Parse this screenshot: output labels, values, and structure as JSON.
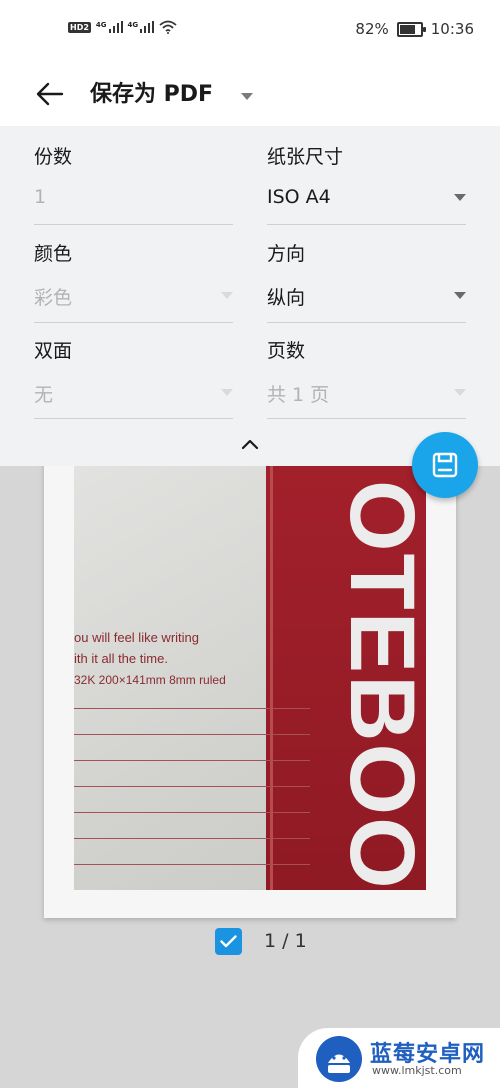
{
  "status_bar": {
    "hd_label": "HD",
    "hd_sub": "2",
    "signal1_label": "4G",
    "signal2_label": "4G",
    "battery_percent": "82%",
    "battery_level": 0.82,
    "time": "10:36"
  },
  "app_bar": {
    "back_icon": "arrow-left-icon",
    "title": "保存为 PDF",
    "title_dropdown_icon": "caret-down-icon"
  },
  "settings": {
    "copies": {
      "label": "份数",
      "value": "1",
      "enabled": false
    },
    "paper_size": {
      "label": "纸张尺寸",
      "value": "ISO A4",
      "enabled": true
    },
    "color": {
      "label": "颜色",
      "value": "彩色",
      "enabled": false
    },
    "orientation": {
      "label": "方向",
      "value": "纵向",
      "enabled": true
    },
    "duplex": {
      "label": "双面",
      "value": "无",
      "enabled": false
    },
    "pages": {
      "label": "页数",
      "value": "共 1 页",
      "enabled": false
    },
    "collapse_icon": "chevron-up-icon"
  },
  "fab": {
    "icon": "save-icon",
    "color": "#1aa5ea"
  },
  "preview": {
    "photo_text": {
      "line1": "ou will feel like writing",
      "line2": "ith it all the time.",
      "line3": "32K  200×141mm  8mm ruled",
      "brand": "OTEBOOK"
    },
    "page_selected": true,
    "page_counter": "1 / 1"
  },
  "watermark": {
    "name": "蓝莓安卓网",
    "url": "www.lmkjst.com"
  },
  "colors": {
    "accent": "#1aa5ea",
    "checkbox": "#1a93e0",
    "panel_bg": "#f1f2f4",
    "preview_bg": "#d6d6d6",
    "notebook_red": "#a3202b"
  }
}
